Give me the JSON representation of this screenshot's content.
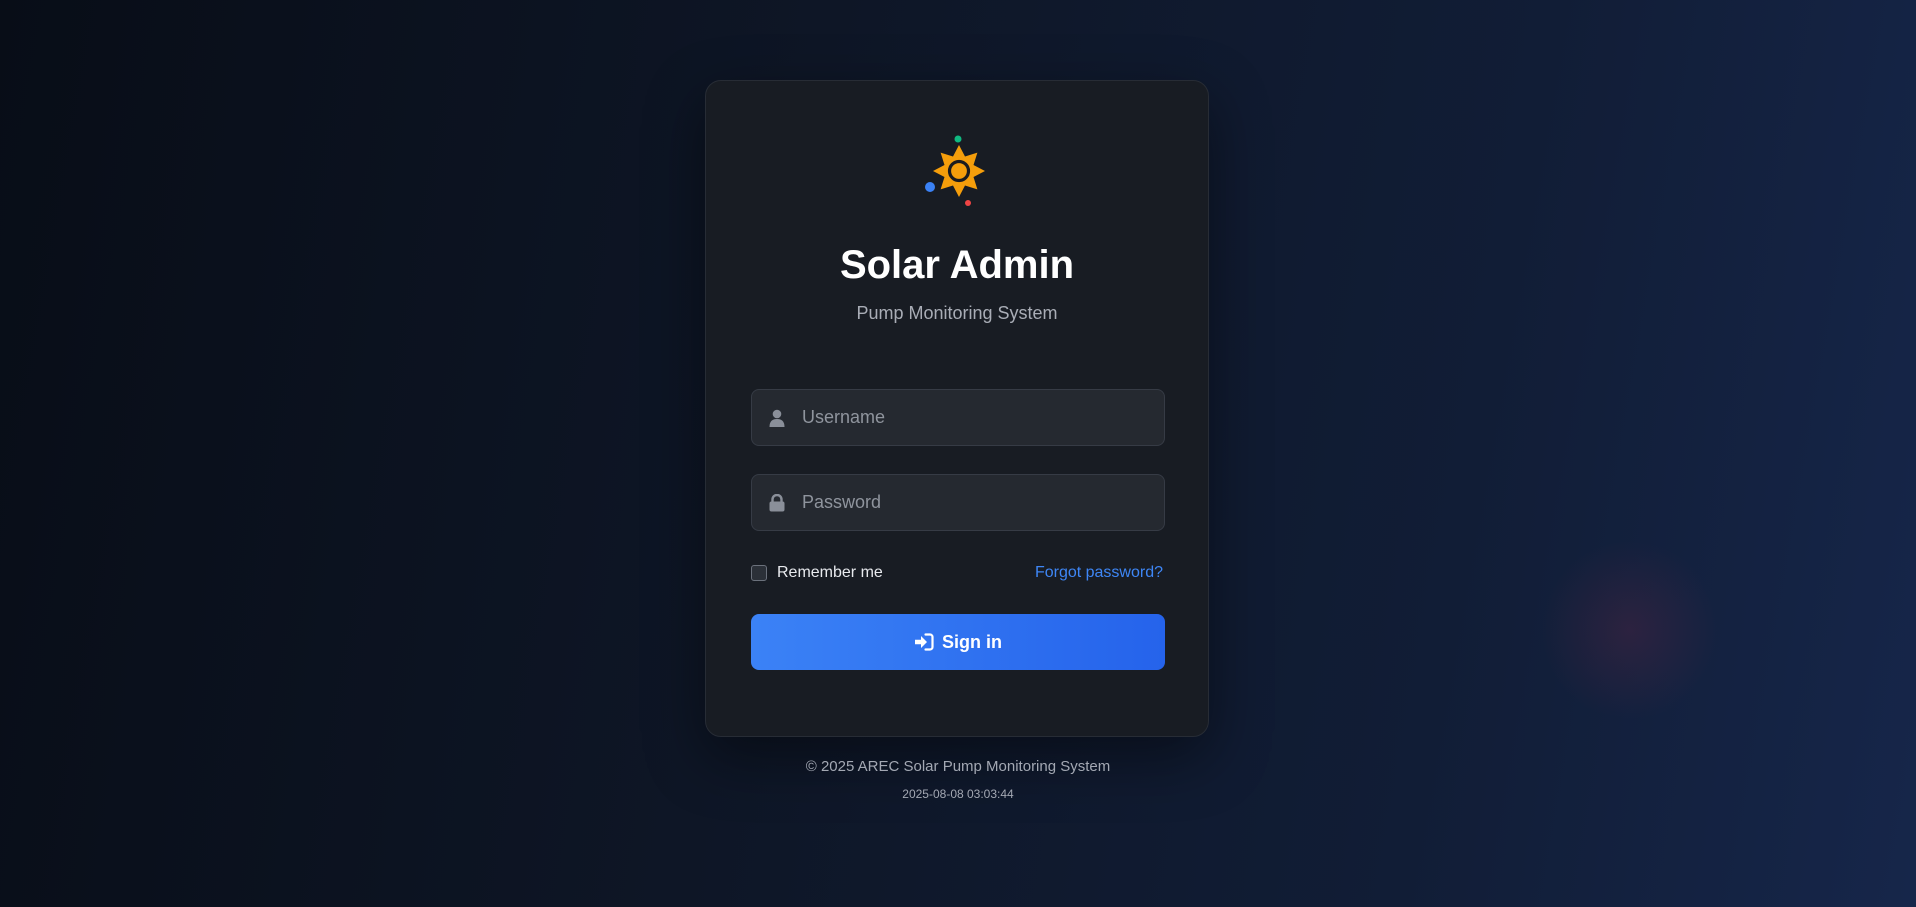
{
  "app": {
    "title": "Solar Admin",
    "subtitle": "Pump Monitoring System",
    "logo_icon": "sun-icon"
  },
  "form": {
    "username": {
      "placeholder": "Username",
      "value": "",
      "icon": "user-icon"
    },
    "password": {
      "placeholder": "Password",
      "value": "",
      "icon": "lock-icon"
    },
    "remember_label": "Remember me",
    "remember_checked": false,
    "forgot_label": "Forgot password?",
    "submit_label": "Sign in",
    "submit_icon": "sign-in-icon"
  },
  "footer": {
    "copyright": "© 2025 AREC Solar Pump Monitoring System",
    "timestamp": "2025-08-08 03:03:44"
  },
  "colors": {
    "accent": "#3b82f6",
    "sun": "#f59e0b",
    "dot_green": "#10b981",
    "dot_blue": "#3b82f6",
    "dot_red": "#ef4444"
  }
}
